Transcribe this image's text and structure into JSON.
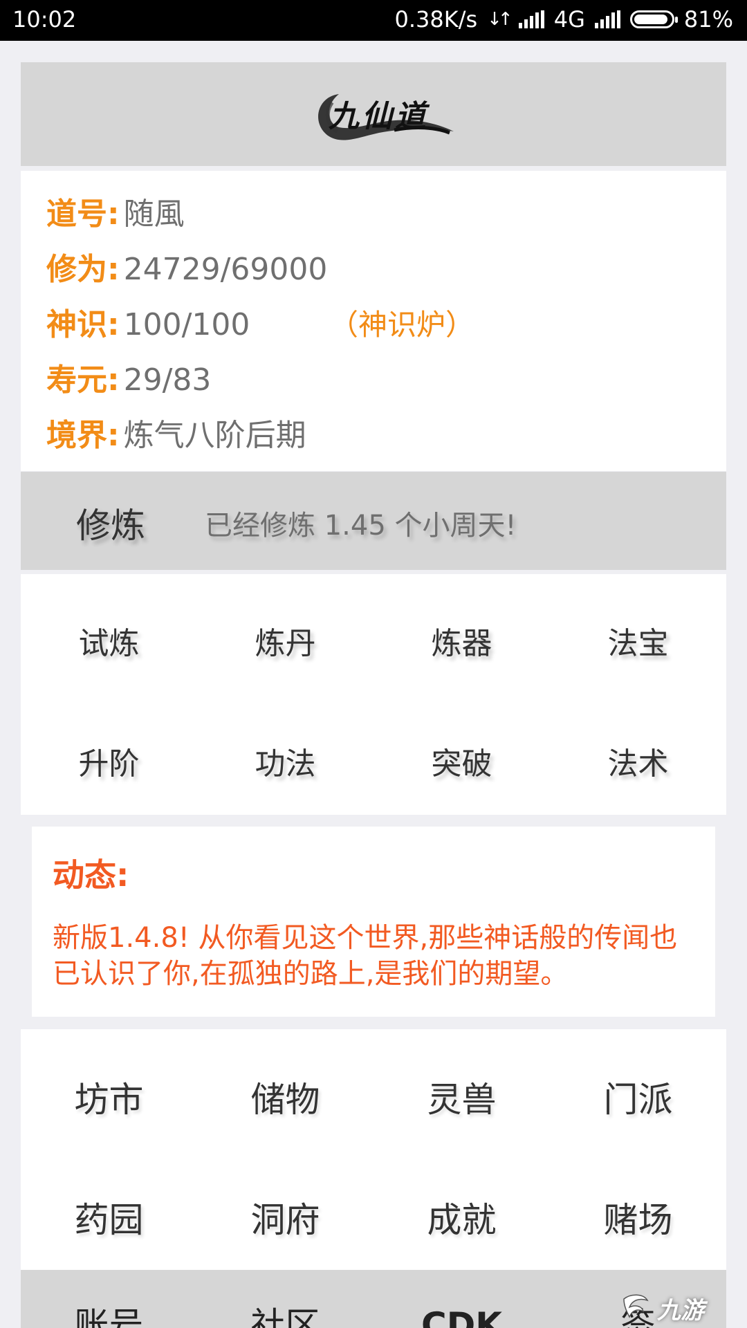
{
  "status_bar": {
    "time": "10:02",
    "net_speed": "0.38K/s",
    "network": "4G",
    "battery": "81%"
  },
  "logo": {
    "text": "九仙道"
  },
  "profile": {
    "rows": [
      {
        "label": "道号:",
        "value": "随風"
      },
      {
        "label": "修为:",
        "value": "24729/69000"
      },
      {
        "label": "神识:",
        "value": "100/100"
      },
      {
        "label": "寿元:",
        "value": "29/83"
      },
      {
        "label": "境界:",
        "value": "炼气八阶后期"
      }
    ],
    "furnace_link": "（神识炉）"
  },
  "cultivation": {
    "button": "修炼",
    "status": "已经修炼 1.45 个小周天!"
  },
  "actions_primary": [
    "试炼",
    "炼丹",
    "炼器",
    "法宝",
    "升阶",
    "功法",
    "突破",
    "法术"
  ],
  "news": {
    "title": "动态:",
    "body": "新版1.4.8! 从你看见这个世界,那些神话般的传闻也已认识了你,在孤独的路上,是我们的期望。"
  },
  "actions_secondary": [
    "坊市",
    "储物",
    "灵兽",
    "门派",
    "药园",
    "洞府",
    "成就",
    "赌场"
  ],
  "bottom_bar": [
    "账号",
    "社区",
    "CDK",
    "签"
  ],
  "watermark": "九游",
  "colors": {
    "label_orange": "#f28c17",
    "news_red": "#f25a22",
    "panel_gray": "#d6d6d6",
    "background": "#efeff3"
  }
}
